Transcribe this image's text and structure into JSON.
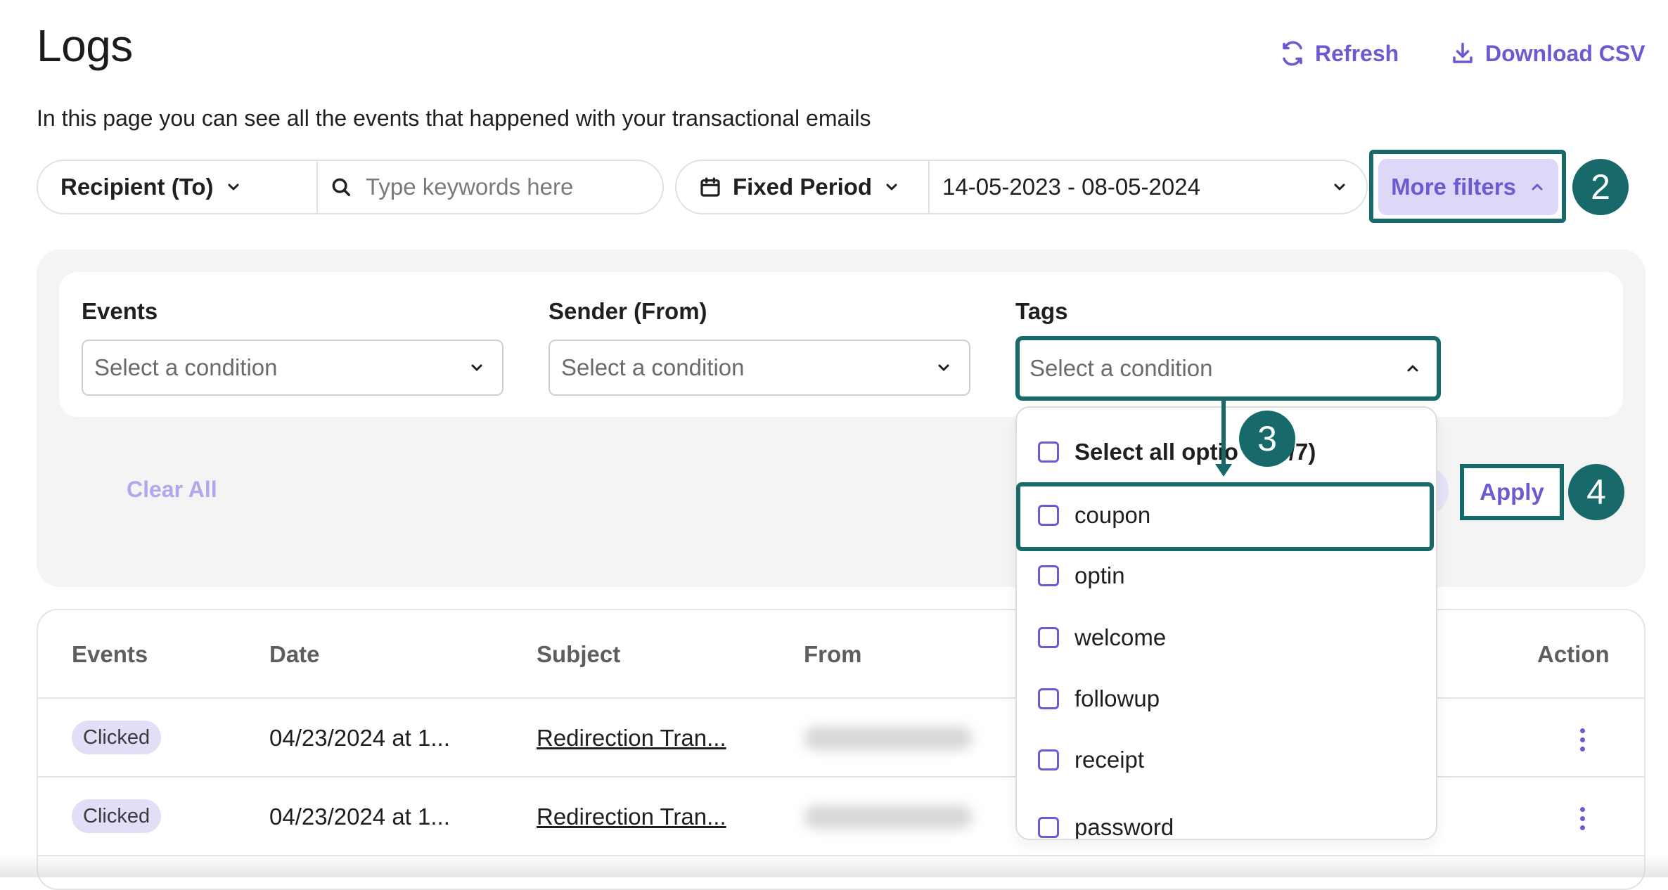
{
  "header": {
    "title": "Logs",
    "subtitle": "In this page you can see all the events that happened with your transactional emails",
    "refresh_label": "Refresh",
    "download_label": "Download CSV"
  },
  "filter_bar": {
    "recipient_label": "Recipient (To)",
    "search_placeholder": "Type keywords here",
    "period_label": "Fixed Period",
    "date_range": "14-05-2023 - 08-05-2024",
    "more_filters_label": "More filters"
  },
  "filters": {
    "events_label": "Events",
    "events_placeholder": "Select a condition",
    "sender_label": "Sender (From)",
    "sender_placeholder": "Select a condition",
    "tags_label": "Tags",
    "tags_placeholder": "Select a condition",
    "clear_all_label": "Clear All",
    "apply_label": "Apply"
  },
  "tags_dropdown": {
    "select_all_visible": "Select all optio",
    "select_all_count_visible": "/7)",
    "options": [
      "coupon",
      "optin",
      "welcome",
      "followup",
      "receipt",
      "password"
    ]
  },
  "annotations": {
    "step_more_filters": "2",
    "step_coupon": "3",
    "step_apply": "4",
    "accent_color": "#176a69"
  },
  "table": {
    "headers": [
      "Events",
      "Date",
      "Subject",
      "From",
      "Action"
    ],
    "rows": [
      {
        "event": "Clicked",
        "date": "04/23/2024 at 1...",
        "subject": "Redirection Tran..."
      },
      {
        "event": "Clicked",
        "date": "04/23/2024 at 1...",
        "subject": "Redirection Tran..."
      }
    ]
  },
  "colors": {
    "brand_purple": "#6c5ad0",
    "pill_purple_bg": "#ddd8f7",
    "panel_bg": "#f4f4f4"
  }
}
